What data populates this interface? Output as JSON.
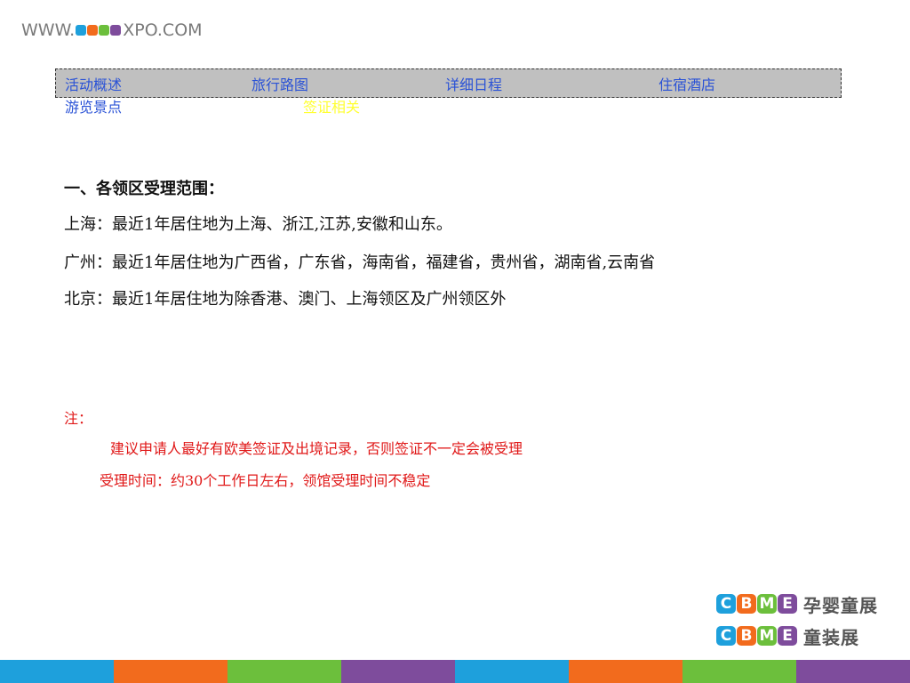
{
  "header": {
    "logo_prefix": "WWW.",
    "logo_brand": "CBME",
    "logo_suffix": "XPO.COM"
  },
  "nav": {
    "items": [
      {
        "label": "活动概述"
      },
      {
        "label": "旅行路图"
      },
      {
        "label": "详细日程"
      },
      {
        "label": "住宿酒店"
      },
      {
        "label": "游览景点"
      },
      {
        "label": "签证相关"
      }
    ],
    "active_color": "#ffff33",
    "link_color": "#2a52d6"
  },
  "content": {
    "heading": "一、各领区受理范围：",
    "lines": [
      "上海：最近1年居住地为上海、浙江,江苏,安徽和山东。",
      "广州：最近1年居住地为广西省，广东省，海南省，福建省，贵州省，湖南省,云南省",
      "北京：最近1年居住地为除香港、澳门、上海领区及广州领区外"
    ]
  },
  "note": {
    "label": "注：",
    "items": [
      "建议申请人最好有欧美签证及出境记录，否则签证不一定会被受理",
      "受理时间：约30个工作日左右，领馆受理时间不稳定"
    ],
    "color": "#e01818"
  },
  "brand": {
    "name": "CBME",
    "row1_text": "孕婴童展",
    "row2_text": "童装展",
    "colors": [
      "#2aa3e0",
      "#f26b1d",
      "#8dc63f",
      "#8e4e9e"
    ]
  },
  "footer_colors": [
    "#1ea0dc",
    "#f26b1d",
    "#6cbf3c",
    "#7e4c9c",
    "#1ea0dc",
    "#f26b1d",
    "#6cbf3c",
    "#7e4c9c"
  ]
}
